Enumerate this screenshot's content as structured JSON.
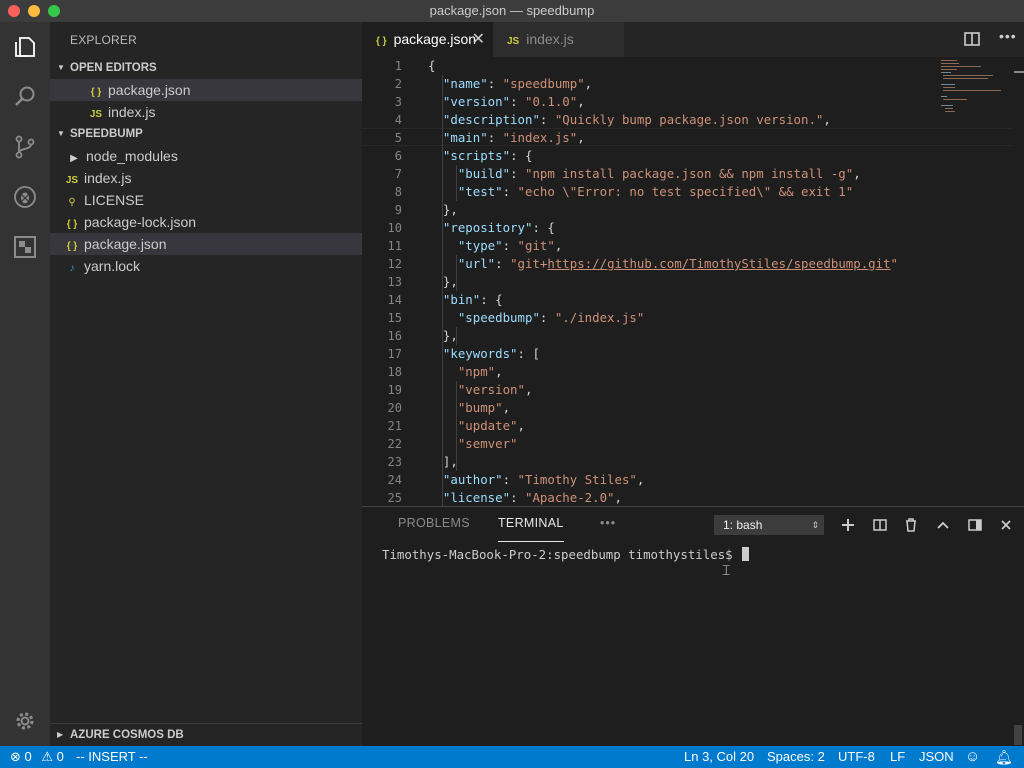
{
  "window": {
    "title": "package.json — speedbump"
  },
  "sidebar": {
    "title": "EXPLORER",
    "open_editors": {
      "header": "OPEN EDITORS",
      "items": [
        {
          "icon": "json-file-icon",
          "label": "package.json"
        },
        {
          "icon": "js-file-icon",
          "label": "index.js"
        }
      ]
    },
    "project": {
      "header": "SPEEDBUMP",
      "items": [
        {
          "icon": "folder-chevron-icon",
          "label": "node_modules"
        },
        {
          "icon": "js-file-icon",
          "label": "index.js"
        },
        {
          "icon": "license-icon",
          "label": "LICENSE"
        },
        {
          "icon": "json-file-icon",
          "label": "package-lock.json"
        },
        {
          "icon": "json-file-icon",
          "label": "package.json"
        },
        {
          "icon": "yarn-icon",
          "label": "yarn.lock"
        }
      ]
    },
    "footer_section": "AZURE COSMOS DB"
  },
  "tabs": [
    {
      "label": "package.json",
      "icon_text": "{ }",
      "active": true
    },
    {
      "label": "index.js",
      "icon_text": "JS",
      "active": false
    }
  ],
  "icon_text": {
    "json": "{ }",
    "js": "JS"
  },
  "code_lines": [
    {
      "n": "1",
      "parts": [
        [
          "p",
          "{"
        ]
      ]
    },
    {
      "n": "2",
      "parts": [
        [
          "p",
          "  "
        ],
        [
          "k",
          "\"name\""
        ],
        [
          "p",
          ": "
        ],
        [
          "s",
          "\"speedbump\""
        ],
        [
          "p",
          ","
        ]
      ]
    },
    {
      "n": "3",
      "parts": [
        [
          "p",
          "  "
        ],
        [
          "k",
          "\"version\""
        ],
        [
          "p",
          ": "
        ],
        [
          "s",
          "\"0.1.0\""
        ],
        [
          "p",
          ","
        ]
      ]
    },
    {
      "n": "4",
      "parts": [
        [
          "p",
          "  "
        ],
        [
          "k",
          "\"description\""
        ],
        [
          "p",
          ": "
        ],
        [
          "s",
          "\"Quickly bump package.json version.\""
        ],
        [
          "p",
          ","
        ]
      ]
    },
    {
      "n": "5",
      "parts": [
        [
          "p",
          "  "
        ],
        [
          "k",
          "\"main\""
        ],
        [
          "p",
          ": "
        ],
        [
          "s",
          "\"index.js\""
        ],
        [
          "p",
          ","
        ]
      ]
    },
    {
      "n": "6",
      "parts": [
        [
          "p",
          "  "
        ],
        [
          "k",
          "\"scripts\""
        ],
        [
          "p",
          ": {"
        ]
      ]
    },
    {
      "n": "7",
      "parts": [
        [
          "p",
          "    "
        ],
        [
          "k",
          "\"build\""
        ],
        [
          "p",
          ": "
        ],
        [
          "s",
          "\"npm install package.json && npm install -g\""
        ],
        [
          "p",
          ","
        ]
      ]
    },
    {
      "n": "8",
      "parts": [
        [
          "p",
          "    "
        ],
        [
          "k",
          "\"test\""
        ],
        [
          "p",
          ": "
        ],
        [
          "s",
          "\"echo \\\"Error: no test specified\\\" && exit 1\""
        ]
      ]
    },
    {
      "n": "9",
      "parts": [
        [
          "p",
          "  },"
        ]
      ]
    },
    {
      "n": "10",
      "parts": [
        [
          "p",
          "  "
        ],
        [
          "k",
          "\"repository\""
        ],
        [
          "p",
          ": {"
        ]
      ]
    },
    {
      "n": "11",
      "parts": [
        [
          "p",
          "    "
        ],
        [
          "k",
          "\"type\""
        ],
        [
          "p",
          ": "
        ],
        [
          "s",
          "\"git\""
        ],
        [
          "p",
          ","
        ]
      ]
    },
    {
      "n": "12",
      "parts": [
        [
          "p",
          "    "
        ],
        [
          "k",
          "\"url\""
        ],
        [
          "p",
          ": "
        ],
        [
          "s",
          "\"git+"
        ],
        [
          "u",
          "https://github.com/TimothyStiles/speedbump.git"
        ],
        [
          "s",
          "\""
        ]
      ]
    },
    {
      "n": "13",
      "parts": [
        [
          "p",
          "  },"
        ]
      ]
    },
    {
      "n": "14",
      "parts": [
        [
          "p",
          "  "
        ],
        [
          "k",
          "\"bin\""
        ],
        [
          "p",
          ": {"
        ]
      ]
    },
    {
      "n": "15",
      "parts": [
        [
          "p",
          "    "
        ],
        [
          "k",
          "\"speedbump\""
        ],
        [
          "p",
          ": "
        ],
        [
          "s",
          "\"./index.js\""
        ]
      ]
    },
    {
      "n": "16",
      "parts": [
        [
          "p",
          "  },"
        ]
      ]
    },
    {
      "n": "17",
      "parts": [
        [
          "p",
          "  "
        ],
        [
          "k",
          "\"keywords\""
        ],
        [
          "p",
          ": ["
        ]
      ]
    },
    {
      "n": "18",
      "parts": [
        [
          "p",
          "    "
        ],
        [
          "s",
          "\"npm\""
        ],
        [
          "p",
          ","
        ]
      ]
    },
    {
      "n": "19",
      "parts": [
        [
          "p",
          "    "
        ],
        [
          "s",
          "\"version\""
        ],
        [
          "p",
          ","
        ]
      ]
    },
    {
      "n": "20",
      "parts": [
        [
          "p",
          "    "
        ],
        [
          "s",
          "\"bump\""
        ],
        [
          "p",
          ","
        ]
      ]
    },
    {
      "n": "21",
      "parts": [
        [
          "p",
          "    "
        ],
        [
          "s",
          "\"update\""
        ],
        [
          "p",
          ","
        ]
      ]
    },
    {
      "n": "22",
      "parts": [
        [
          "p",
          "    "
        ],
        [
          "s",
          "\"semver\""
        ]
      ]
    },
    {
      "n": "23",
      "parts": [
        [
          "p",
          "  ],"
        ]
      ]
    },
    {
      "n": "24",
      "parts": [
        [
          "p",
          "  "
        ],
        [
          "k",
          "\"author\""
        ],
        [
          "p",
          ": "
        ],
        [
          "s",
          "\"Timothy Stiles\""
        ],
        [
          "p",
          ","
        ]
      ]
    },
    {
      "n": "25",
      "parts": [
        [
          "p",
          "  "
        ],
        [
          "k",
          "\"license\""
        ],
        [
          "p",
          ": "
        ],
        [
          "s",
          "\"Apache-2.0\""
        ],
        [
          "p",
          ","
        ]
      ]
    }
  ],
  "panel": {
    "tabs": [
      "PROBLEMS",
      "TERMINAL"
    ],
    "active_tab": "TERMINAL",
    "more": "•••",
    "terminal_select": "1: bash",
    "prompt": "Timothys-MacBook-Pro-2:speedbump timothystiles$ "
  },
  "status": {
    "errors": "0",
    "warnings": "0",
    "mode": "-- INSERT --",
    "position": "Ln 3, Col 20",
    "spaces": "Spaces: 2",
    "encoding": "UTF-8",
    "eol": "LF",
    "language": "JSON"
  },
  "colors": {
    "accent": "#007acc",
    "key": "#9cdcfe",
    "string": "#ce9178",
    "json_icon": "#cbcb41"
  }
}
